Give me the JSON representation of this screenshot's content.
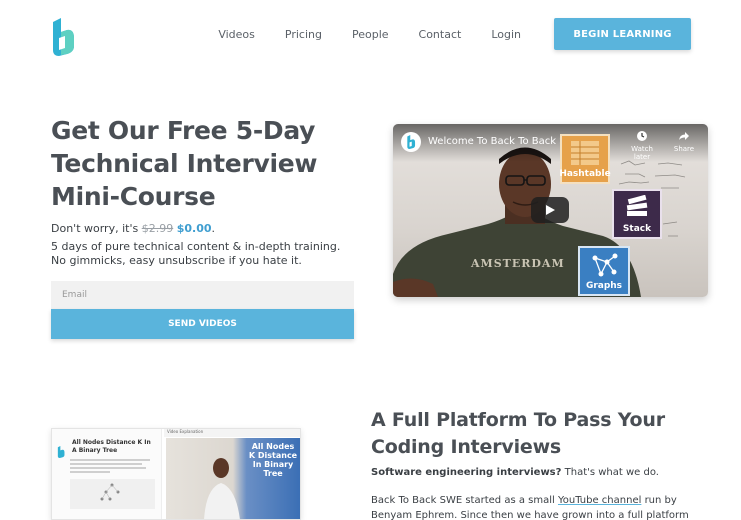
{
  "colors": {
    "accent": "#5ab4dc",
    "price": "#3f9ed0",
    "heading": "#4a4f55"
  },
  "nav": {
    "logo_icon": "b-logo-icon",
    "links": [
      "Videos",
      "Pricing",
      "People",
      "Contact",
      "Login"
    ],
    "cta": "BEGIN LEARNING"
  },
  "hero": {
    "title": "Get Our Free 5-Day Technical Interview Mini-Course",
    "price_prefix": "Don't worry, it's ",
    "price_old": "$2.99",
    "price_new": "$0.00",
    "price_suffix": ".",
    "description": "5 days of pure technical content & in-depth training. No gimmicks, easy unsubscribe if you hate it.",
    "email_placeholder": "Email",
    "send_button": "SEND VIDEOS"
  },
  "video": {
    "title": "Welcome To Back To Back SWE",
    "watch_later": "Watch later",
    "share": "Share",
    "shirt_text": "AMSTERDAM",
    "cards": [
      "Hashtable",
      "Stack",
      "Graphs"
    ]
  },
  "section2": {
    "screenshot": {
      "problem_title": "All Nodes Distance K In A Binary Tree",
      "tab_label": "Video Explanation",
      "video_title": "All Nodes K Distance In Binary Tree"
    },
    "title": "A Full Platform To Pass Your Coding Interviews",
    "subtitle_bold": "Software engineering interviews?",
    "subtitle_rest": " That's what we do.",
    "body_before": "Back To Back SWE started as a small ",
    "body_link": "YouTube channel",
    "body_after": " run by Benyam Ephrem. Since then we have grown into a full platform"
  }
}
